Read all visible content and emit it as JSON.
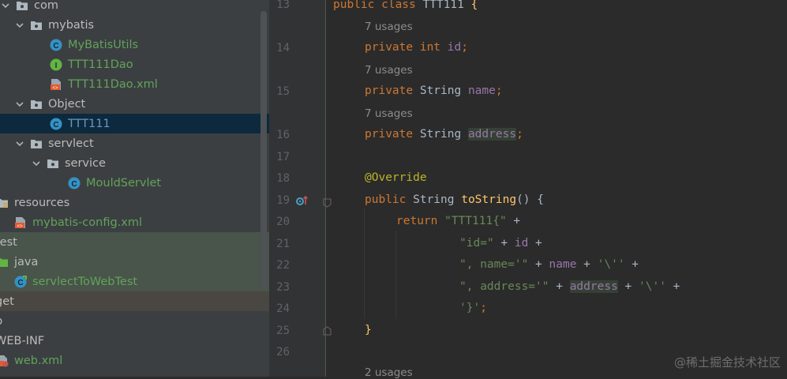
{
  "project_tree": {
    "items": [
      {
        "label": "com",
        "icon": "package-folder-icon",
        "color": "default",
        "arrow": "down"
      },
      {
        "label": "mybatis",
        "icon": "package-folder-icon",
        "color": "default",
        "arrow": "down"
      },
      {
        "label": "MyBatisUtils",
        "icon": "java-class-icon",
        "color": "green",
        "arrow": "none"
      },
      {
        "label": "TTT111Dao",
        "icon": "java-interface-icon",
        "color": "green",
        "arrow": "none"
      },
      {
        "label": "TTT111Dao.xml",
        "icon": "xml-file-icon",
        "color": "green",
        "arrow": "none"
      },
      {
        "label": "Object",
        "icon": "package-folder-icon",
        "color": "default",
        "arrow": "down"
      },
      {
        "label": "TTT111",
        "icon": "java-class-icon",
        "color": "blue",
        "arrow": "none",
        "selected": true
      },
      {
        "label": "servlect",
        "icon": "package-folder-icon",
        "color": "default",
        "arrow": "down"
      },
      {
        "label": "service",
        "icon": "package-folder-icon",
        "color": "default",
        "arrow": "down"
      },
      {
        "label": "MouldServlet",
        "icon": "java-class-icon",
        "color": "green",
        "arrow": "none"
      },
      {
        "label": "resources",
        "icon": "resources-folder-icon",
        "color": "default",
        "arrow": "none"
      },
      {
        "label": "mybatis-config.xml",
        "icon": "xml-file-icon",
        "color": "green",
        "arrow": "none"
      },
      {
        "label": "test",
        "icon": "none",
        "color": "default",
        "arrow": "none",
        "band": "test"
      },
      {
        "label": "java",
        "icon": "test-source-folder-icon",
        "color": "default",
        "arrow": "none",
        "band": "test"
      },
      {
        "label": "servlectToWebTest",
        "icon": "java-test-class-icon",
        "color": "green",
        "arrow": "none",
        "band": "test"
      },
      {
        "label": "get",
        "icon": "none",
        "color": "default",
        "arrow": "none",
        "band": "target"
      },
      {
        "label": "p",
        "icon": "none",
        "color": "default",
        "arrow": "none"
      },
      {
        "label": "WEB-INF",
        "icon": "none",
        "color": "default",
        "arrow": "none"
      },
      {
        "label": "web.xml",
        "icon": "web-xml-icon",
        "color": "green",
        "arrow": "none"
      }
    ]
  },
  "editor": {
    "lines": [
      {
        "num": "13",
        "hint": ""
      },
      {
        "num": "14",
        "hint": "7 usages"
      },
      {
        "num": "15",
        "hint": "7 usages"
      },
      {
        "num": "16",
        "hint": "7 usages"
      },
      {
        "num": "17",
        "hint": ""
      },
      {
        "num": "18",
        "hint": ""
      },
      {
        "num": "19",
        "hint": ""
      },
      {
        "num": "20",
        "hint": ""
      },
      {
        "num": "21",
        "hint": ""
      },
      {
        "num": "22",
        "hint": ""
      },
      {
        "num": "23",
        "hint": ""
      },
      {
        "num": "24",
        "hint": ""
      },
      {
        "num": "25",
        "hint": ""
      },
      {
        "num": "26",
        "hint": ""
      }
    ],
    "bottom_hint": "2 usages",
    "code": {
      "l13_kw": "public class ",
      "l13_name": "TTT111",
      "l13_brace": " {",
      "l14_kw": "private int ",
      "l14_field": "id",
      "l14_end": ";",
      "l15_kw": "private ",
      "l15_type": "String ",
      "l15_field": "name",
      "l15_end": ";",
      "l16_kw": "private ",
      "l16_type": "String ",
      "l16_field": "address",
      "l16_end": ";",
      "l18_ann": "@Override",
      "l19_kw": "public ",
      "l19_type": "String ",
      "l19_fn": "toString",
      "l19_end": "() {",
      "l20_kw": "return ",
      "l20_str": "\"TTT111{\"",
      "l20_end": " +",
      "l21_str": "\"id=\"",
      "l21_mid": " + ",
      "l21_field": "id",
      "l21_end": " +",
      "l22_str": "\", name='\"",
      "l22_mid": " + ",
      "l22_field": "name",
      "l22_mid2": " + ",
      "l22_str2": "'\\''",
      "l22_end": " +",
      "l23_str": "\", address='\"",
      "l23_mid": " + ",
      "l23_field": "address",
      "l23_mid2": " + ",
      "l23_str2": "'\\''",
      "l23_end": " +",
      "l24_str": "'}'",
      "l24_end": ";",
      "l25_brace": "}"
    }
  },
  "watermark": "@稀土掘金技术社区",
  "colors": {
    "keyword": "#cc7832",
    "field": "#9876aa",
    "method": "#ffc66d",
    "string": "#6a8759",
    "annotation": "#bbb529"
  }
}
